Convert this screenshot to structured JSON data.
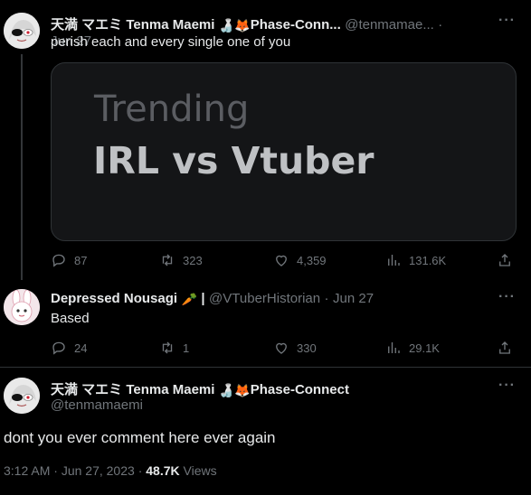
{
  "tweet1": {
    "name": "天満 マエミ Tenma Maemi",
    "name_suffix": "Phase-Conn...",
    "handle": "@tenmamae...",
    "sep": "·",
    "date": "Jun 27",
    "text": "perish each and every single one of you",
    "image": {
      "line1": "Trending",
      "line2": "IRL vs Vtuber"
    },
    "stats": {
      "replies": "87",
      "retweets": "323",
      "likes": "4,359",
      "views": "131.6K"
    }
  },
  "tweet2": {
    "name": "Depressed Nousagi",
    "name_mark": "|",
    "handle": "@VTuberHistorian",
    "sep": "·",
    "date": "Jun 27",
    "text": "Based",
    "stats": {
      "replies": "24",
      "retweets": "1",
      "likes": "330",
      "views": "29.1K"
    }
  },
  "tweet3": {
    "name": "天満 マエミ Tenma Maemi",
    "name_suffix": "Phase-Connect",
    "handle": "@tenmamaemi",
    "text": "dont you ever comment here ever again",
    "time": "3:12 AM",
    "date": "Jun 27, 2023",
    "views_count": "48.7K",
    "views_label": "Views",
    "sep": "·"
  },
  "icons": {
    "more": "more-horizontal-icon",
    "reply": "reply-bubble-icon",
    "retweet": "retweet-icon",
    "like": "heart-icon",
    "views": "bar-chart-icon",
    "share": "share-upload-icon"
  },
  "colors": {
    "background": "#000000",
    "text": "#e7e9ea",
    "muted": "#71767b",
    "border": "#2f3336"
  }
}
